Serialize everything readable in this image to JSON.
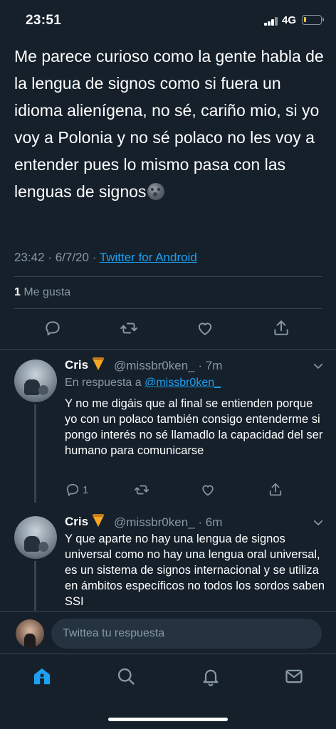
{
  "status": {
    "time": "23:51",
    "network": "4G",
    "battery_level": 0.12
  },
  "main_tweet": {
    "text": "Me parece curioso como la gente habla de la lengua de signos como si fuera un idioma alienígena, no sé, cariño mio, si yo voy a Polonia y no sé polaco no les voy a entender pues lo mismo pasa con las lenguas de signos",
    "emoji": "moon-face-emoji",
    "time": "23:42",
    "date": "6/7/20",
    "separator": "·",
    "source": "Twitter for Android",
    "like_count": "1",
    "like_label": "Me gusta"
  },
  "replies": [
    {
      "name": "Cris",
      "handle": "@missbr0ken_ · 7m",
      "reply_to_label": "En respuesta a",
      "reply_to_mention": "@missbr0ken_",
      "text": "Y no me digáis que al final se entienden porque yo con un polaco también consigo entenderme si pongo interés no sé llamadlo la capacidad del ser humano para comunicarse",
      "reply_count": "1"
    },
    {
      "name": "Cris",
      "handle": "@missbr0ken_ · 6m",
      "text": "Y que aparte no hay una lengua de signos universal como no hay una lengua oral universal, es un sistema de signos internacional y se utiliza en ámbitos específicos no todos los sordos saben SSI"
    }
  ],
  "compose": {
    "placeholder": "Twittea tu respuesta"
  },
  "colors": {
    "background": "#15202b",
    "accent": "#1da1f2",
    "muted": "#8899a6",
    "divider": "#38444d"
  },
  "tabs": [
    "home-icon",
    "search-icon",
    "notifications-icon",
    "messages-icon"
  ]
}
